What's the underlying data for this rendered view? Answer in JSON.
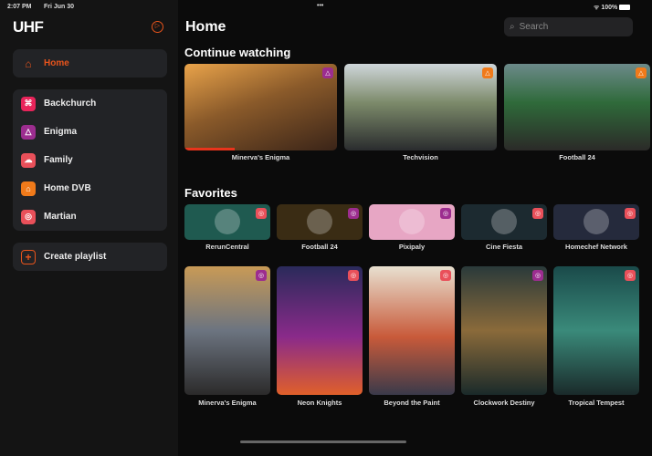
{
  "status": {
    "time": "2:07 PM",
    "date": "Fri Jun 30",
    "battery": "100%"
  },
  "sidebar": {
    "logo": "UHF",
    "home": "Home",
    "channels": [
      {
        "label": "Backchurch",
        "color": "#e8245a",
        "icon": "⌘"
      },
      {
        "label": "Enigma",
        "color": "#9c2d8f",
        "icon": "△"
      },
      {
        "label": "Family",
        "color": "#e9505a",
        "icon": "☁"
      },
      {
        "label": "Home DVB",
        "color": "#f07a1a",
        "icon": "⌂"
      },
      {
        "label": "Martian",
        "color": "#e9505a",
        "icon": "◎"
      }
    ],
    "create": "Create playlist"
  },
  "header": {
    "title": "Home",
    "search_placeholder": "Search"
  },
  "continue": {
    "title": "Continue watching",
    "items": [
      {
        "label": "Minerva's Enigma",
        "bg": "linear-gradient(160deg,#e9a34a,#8a5a2a 45%,#3a2418)",
        "badge": "#9c2d8f",
        "progress": 0.33
      },
      {
        "label": "Techvision",
        "bg": "linear-gradient(180deg,#cfd6da,#7c8a6a 45%,#2a2c2e)",
        "badge": "#f07a1a",
        "progress": 0
      },
      {
        "label": "Football 24",
        "bg": "linear-gradient(180deg,#6c8a8a,#2f6a3a 45%,#2b2a28)",
        "badge": "#f07a1a",
        "progress": 0
      }
    ]
  },
  "favorites": {
    "title": "Favorites",
    "items": [
      {
        "label": "RerunCentral",
        "bg": "#1f5a50",
        "badge": "#e9505a"
      },
      {
        "label": "Football 24",
        "bg": "#3a2c14",
        "badge": "#9c2d8f"
      },
      {
        "label": "Pixipaly",
        "bg": "#e7a6c4",
        "badge": "#9c2d8f"
      },
      {
        "label": "Cine Fiesta",
        "bg": "#1c2a30",
        "badge": "#e9505a"
      },
      {
        "label": "Homechef Network",
        "bg": "#252a3c",
        "badge": "#e9505a"
      }
    ]
  },
  "posters": [
    {
      "label": "Minerva's Enigma",
      "bg": "linear-gradient(180deg,#c89a56,#6c7480 50%,#2b2a2a)",
      "badge": "#9c2d8f"
    },
    {
      "label": "Neon Knights",
      "bg": "linear-gradient(180deg,#2a2a5a,#8a2a8a 55%,#e0602a)",
      "badge": "#e9505a"
    },
    {
      "label": "Beyond the Paint",
      "bg": "linear-gradient(180deg,#e8e0d0,#c85a3a 55%,#3a3a4a)",
      "badge": "#e9505a"
    },
    {
      "label": "Clockwork Destiny",
      "bg": "linear-gradient(180deg,#2a3a3a,#8a6a3a 50%,#1a2a2a)",
      "badge": "#9c2d8f"
    },
    {
      "label": "Tropical Tempest",
      "bg": "linear-gradient(180deg,#1a4a4a,#3a8a7a 50%,#1a2a2a)",
      "badge": "#e9505a"
    }
  ]
}
